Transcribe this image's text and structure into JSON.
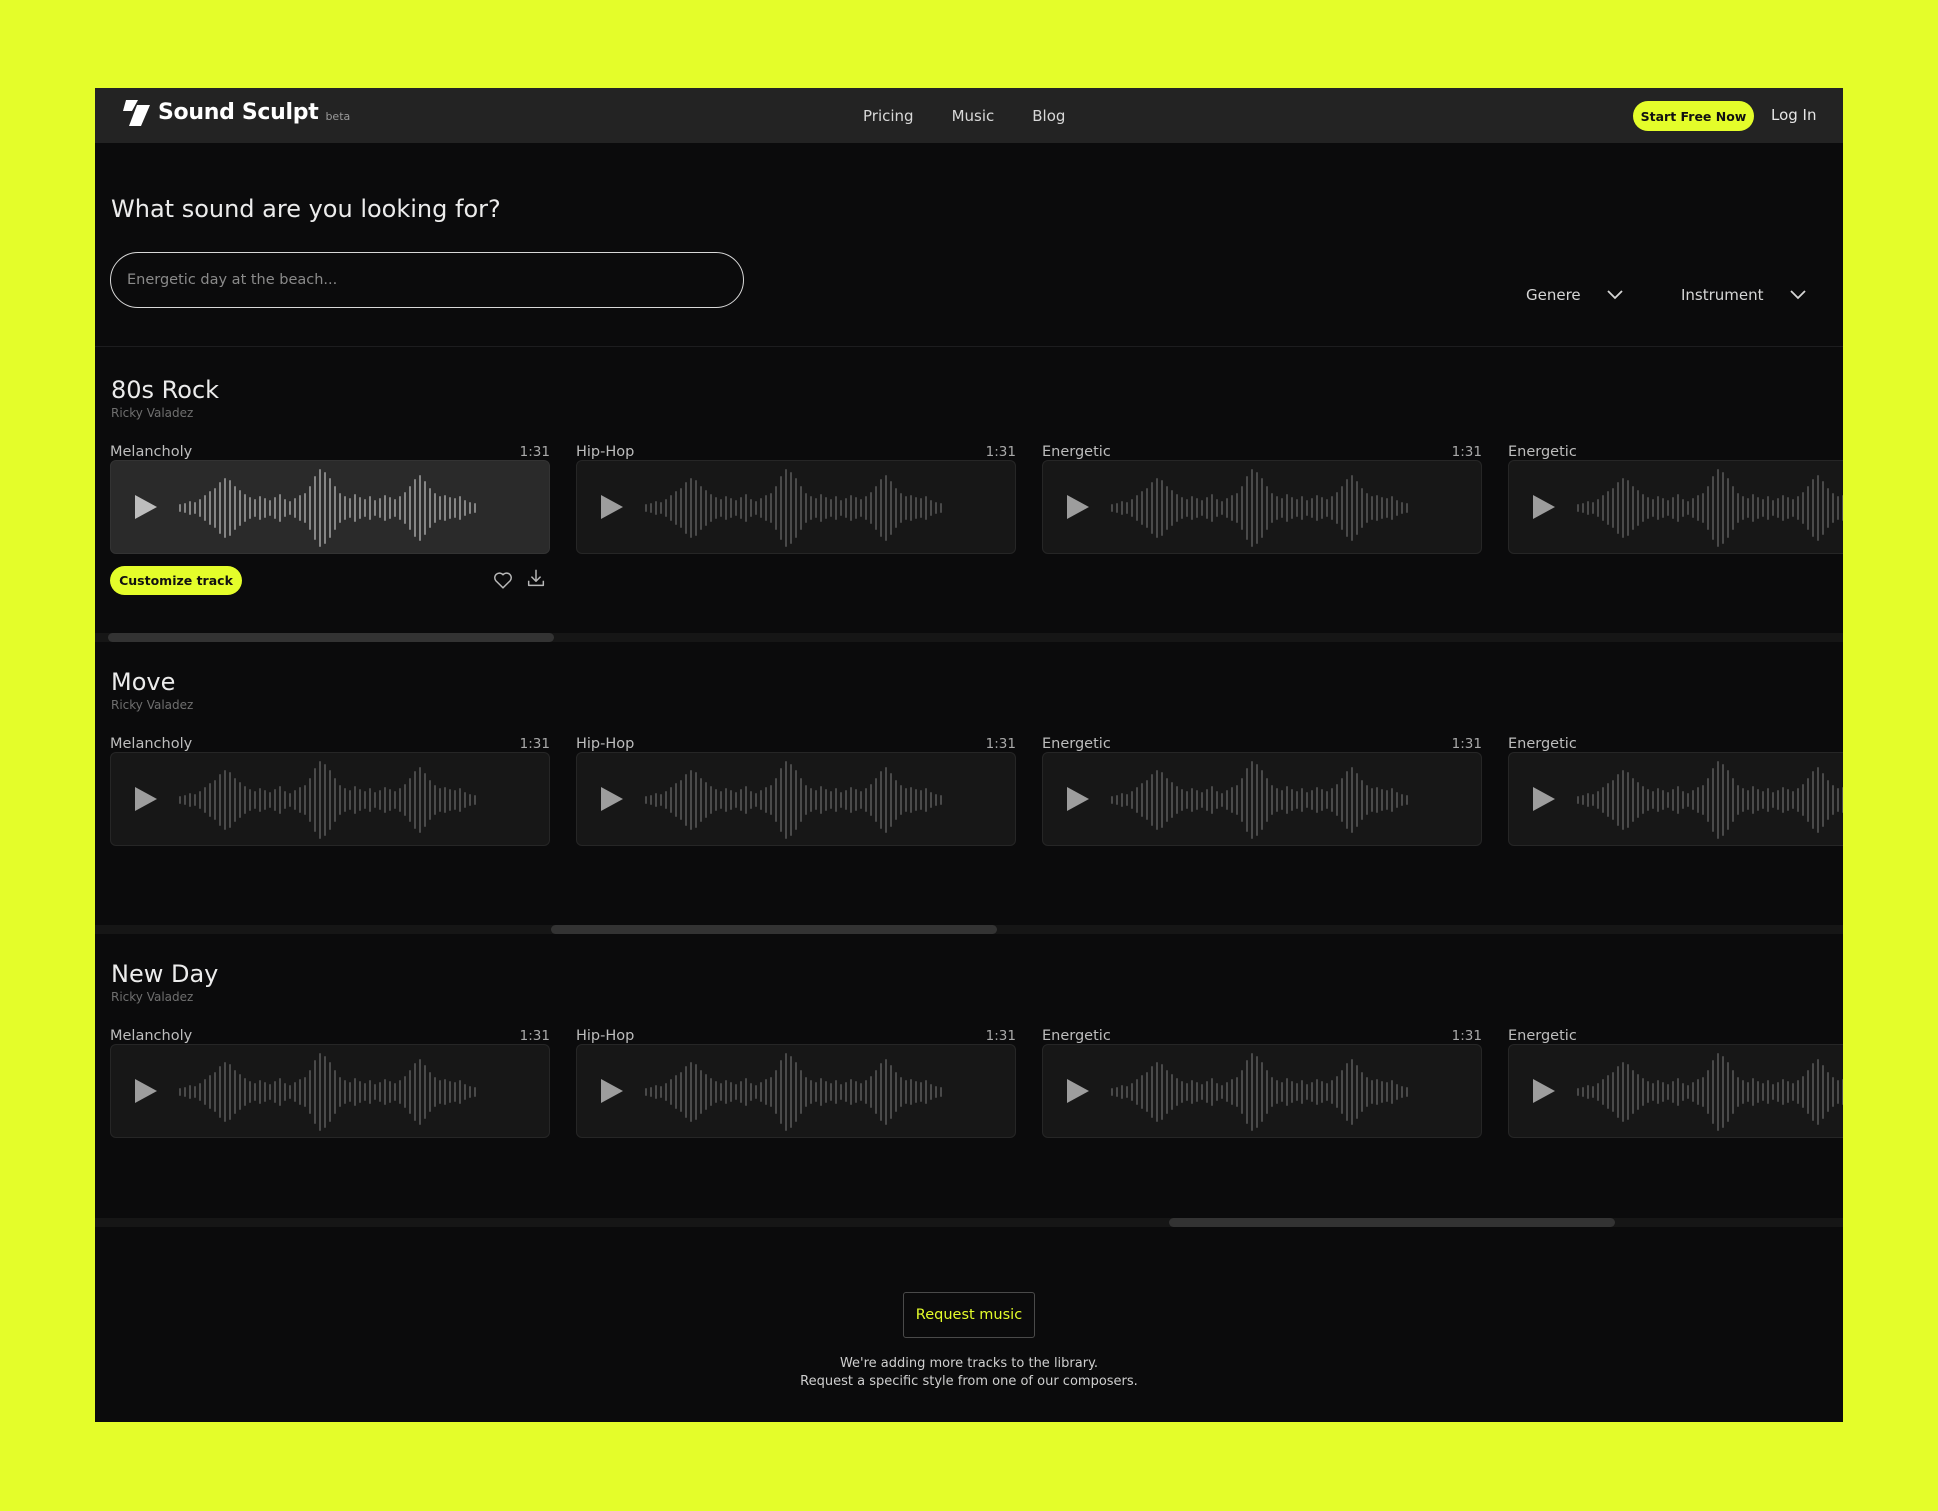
{
  "header": {
    "brand": "Sound Sculpt",
    "badge": "beta",
    "nav": [
      "Pricing",
      "Music",
      "Blog"
    ],
    "cta": "Start Free Now",
    "login": "Log In"
  },
  "search": {
    "title": "What sound are you looking for?",
    "placeholder": "Energetic day at the beach..."
  },
  "filters": {
    "genre": "Genere",
    "instrument": "Instrument"
  },
  "sections": [
    {
      "title": "80s Rock",
      "artist": "Ricky Valadez",
      "tracks": [
        {
          "label": "Melancholy",
          "duration": "1:31"
        },
        {
          "label": "Hip-Hop",
          "duration": "1:31"
        },
        {
          "label": "Energetic",
          "duration": "1:31"
        },
        {
          "label": "Energetic",
          "duration": ""
        }
      ]
    },
    {
      "title": "Move",
      "artist": "Ricky Valadez",
      "tracks": [
        {
          "label": "Melancholy",
          "duration": "1:31"
        },
        {
          "label": "Hip-Hop",
          "duration": "1:31"
        },
        {
          "label": "Energetic",
          "duration": "1:31"
        },
        {
          "label": "Energetic",
          "duration": ""
        }
      ]
    },
    {
      "title": "New Day",
      "artist": "Ricky Valadez",
      "tracks": [
        {
          "label": "Melancholy",
          "duration": "1:31"
        },
        {
          "label": "Hip-Hop",
          "duration": "1:31"
        },
        {
          "label": "Energetic",
          "duration": "1:31"
        },
        {
          "label": "Energetic",
          "duration": ""
        }
      ]
    }
  ],
  "track_actions": {
    "customize": "Customize track",
    "icons": [
      "heart-icon",
      "download-icon"
    ]
  },
  "request": {
    "button": "Request music",
    "line1": "We're adding more tracks to the library.",
    "line2": "Request a specific style from one of our composers."
  },
  "colors": {
    "accent": "#e4fd2a",
    "background": "#0b0b0c",
    "header": "#232323"
  }
}
